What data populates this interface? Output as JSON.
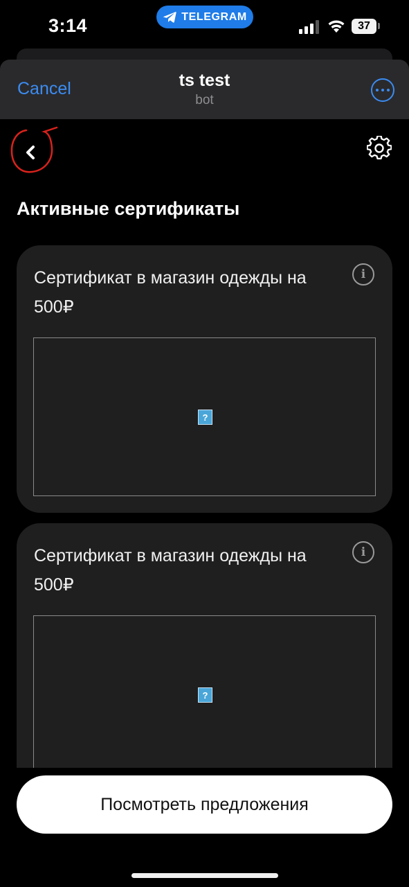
{
  "status_bar": {
    "time": "3:14",
    "source_app": "TELEGRAM",
    "battery": "37"
  },
  "header": {
    "cancel_label": "Cancel",
    "title": "ts test",
    "subtitle": "bot"
  },
  "page": {
    "title": "Активные сертификаты"
  },
  "cards": [
    {
      "title": "Сертификат в магазин одежды на 500₽"
    },
    {
      "title": "Сертификат в магазин одежды на 500₽"
    }
  ],
  "broken_image_glyph": "?",
  "cta": {
    "label": "Посмотреть предложения"
  },
  "icons": {
    "back": "chevron-left-icon",
    "settings": "gear-icon",
    "info": "info-icon",
    "more": "ellipsis-circle-icon",
    "annotation": "red-circle-annotation"
  },
  "colors": {
    "accent": "#3b8cf2",
    "telegram_pill": "#1f7ce8",
    "card_bg": "#1f1f1f",
    "annotation_red": "#d9221c"
  }
}
